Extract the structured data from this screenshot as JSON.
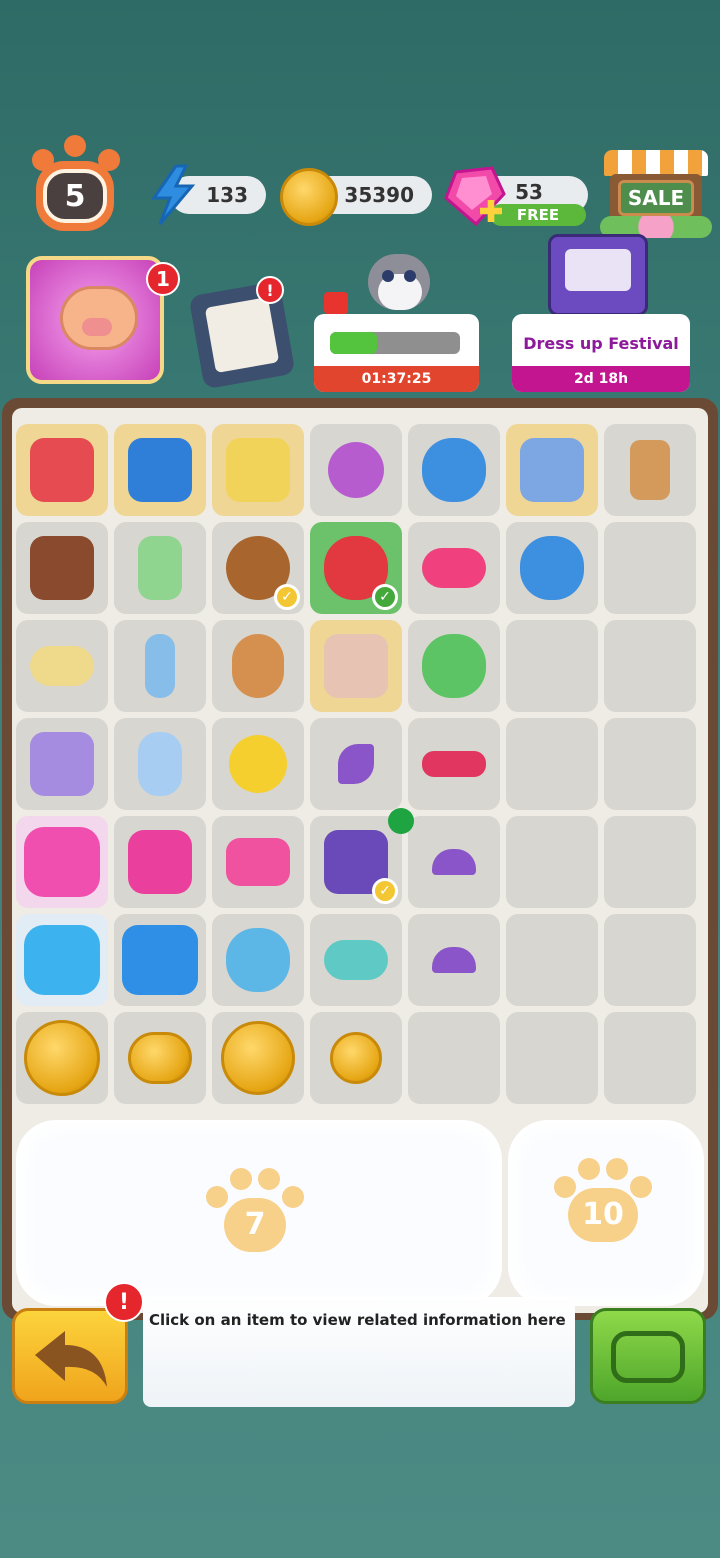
{
  "top": {
    "level": "5",
    "energy": "133",
    "coins": "35390",
    "gems": "53",
    "gems_free_label": "FREE",
    "sale_label": "SALE"
  },
  "badges": {
    "piggy": "1",
    "tasks": "!"
  },
  "events": {
    "cat_timer": "01:37:25",
    "festival_title": "Dress up Festival",
    "festival_time": "2d 18h"
  },
  "locked": {
    "left_count": "7",
    "right_count": "10"
  },
  "info": {
    "text": "Click on an item to view related information here",
    "alert": "!"
  },
  "colors": {
    "accent_pink": "#c2158f",
    "timer_red": "#e2452d",
    "board_brown": "#6b4a35"
  }
}
